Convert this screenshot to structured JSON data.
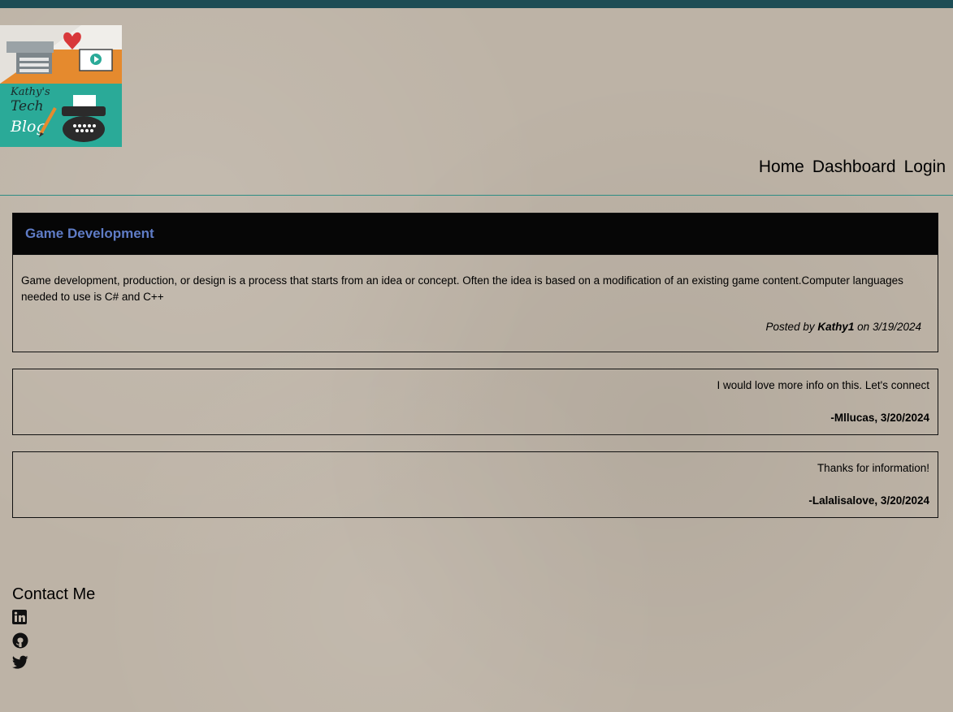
{
  "header": {
    "logo": {
      "text_line1": "Kathy's",
      "text_line2": "Tech",
      "text_line3": "Blog"
    },
    "nav": [
      {
        "label": "Home"
      },
      {
        "label": "Dashboard"
      },
      {
        "label": "Login"
      }
    ]
  },
  "post": {
    "title": "Game Development",
    "body": "Game development, production, or design is a process that starts from an idea or concept. Often the idea is based on a modification of an existing game content.Computer languages needed to use is C# and C++",
    "posted_by_prefix": "Posted by",
    "author": "Kathy1",
    "on_prefix": "on",
    "date": "3/19/2024"
  },
  "comments": [
    {
      "text": "I would love more info on this. Let's connect",
      "author": "-Mllucas, 3/20/2024"
    },
    {
      "text": "Thanks for information!",
      "author": "-Lalalisalove, 3/20/2024"
    }
  ],
  "footer": {
    "contact_title": "Contact Me",
    "icons": [
      "linkedin-icon",
      "github-icon",
      "twitter-icon"
    ]
  },
  "colors": {
    "topbar": "#1d4d55",
    "accent_line": "#2d8d84",
    "post_header_bg": "#060606",
    "post_title": "#5f7cc6",
    "logo_teal": "#2aaa98",
    "logo_orange": "#e58a2e"
  }
}
